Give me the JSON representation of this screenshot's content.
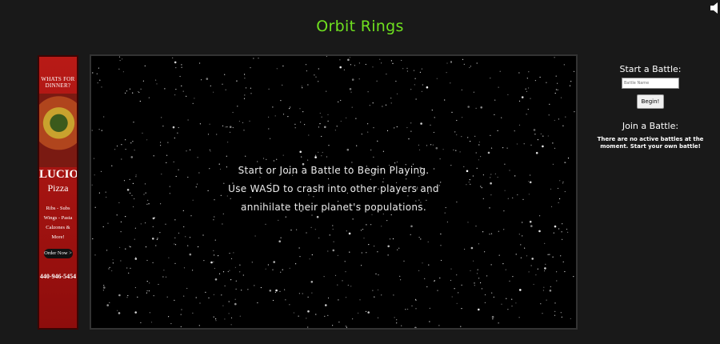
{
  "page": {
    "title": "Orbit Rings"
  },
  "ad": {
    "tagline": "WHATS FOR DINNER?",
    "brand": "LUCIO'S",
    "brand_sub": "Pizza",
    "menu_line1": "Ribs - Subs",
    "menu_line2": "Wings - Pasta",
    "menu_line3": "Calzones & More!",
    "cta": "Order Now >",
    "phone": "440-946-5454"
  },
  "game": {
    "line1": "Start or Join a Battle to Begin Playing.",
    "line2": "Use WASD to crash into other players and",
    "line3": "annihilate their planet's populations."
  },
  "start_battle": {
    "heading": "Start a Battle:",
    "placeholder": "Battle Name",
    "button": "Begin!"
  },
  "join_battle": {
    "heading": "Join a Battle:",
    "message": "There are no active battles at the moment. Start your own battle!"
  },
  "icons": {
    "speaker": "speaker-icon"
  },
  "colors": {
    "title": "#6fe01f",
    "background": "#191919"
  }
}
